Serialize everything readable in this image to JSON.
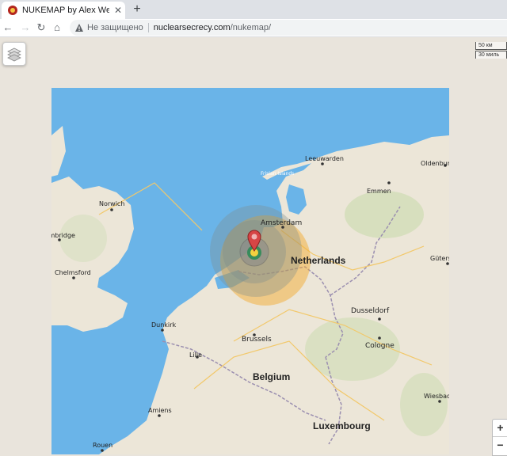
{
  "browser": {
    "tab_title": "NUKEMAP by Alex Wellerstein",
    "tab_close": "✕",
    "new_tab": "+",
    "back": "←",
    "forward": "→",
    "reload": "↻",
    "home": "⌂",
    "security_text": "Не защищено",
    "url_host": "nuclearsecrecy.com",
    "url_path": "/nukemap/"
  },
  "map": {
    "scale_km": "50 км",
    "scale_mi": "30 миль",
    "zoom_in": "+",
    "zoom_out": "−",
    "country_labels": {
      "netherlands": "Netherlands",
      "belgium": "Belgium",
      "luxembourg": "Luxembourg"
    },
    "cities": {
      "leeuwarden": "Leeuwarden",
      "oldenburg": "Oldenburg",
      "frisian": "Frisian Islands",
      "emmen": "Emmen",
      "norwich": "Norwich",
      "cambridge": "Cambridge",
      "amsterdam": "Amsterdam",
      "gutersloh": "Gütersloh",
      "chelmsford": "Chelmsford",
      "dusseldorf": "Dusseldorf",
      "dunkirk": "Dunkirk",
      "brussels": "Brussels",
      "cologne": "Cologne",
      "lille": "Lille",
      "wiesbaden": "Wiesbaden",
      "amiens": "Amiens",
      "rouen": "Rouen"
    },
    "colors": {
      "sea": "#6ab4e8",
      "land": "#ece6d8",
      "fireball": "#f4d03f",
      "radiation": "#2e8b57",
      "blast": "#7f8c8d",
      "thermal": "#f5a623",
      "marker": "#d64545"
    },
    "icons": [
      "layers-icon",
      "map-pin-icon",
      "warning-icon"
    ]
  }
}
